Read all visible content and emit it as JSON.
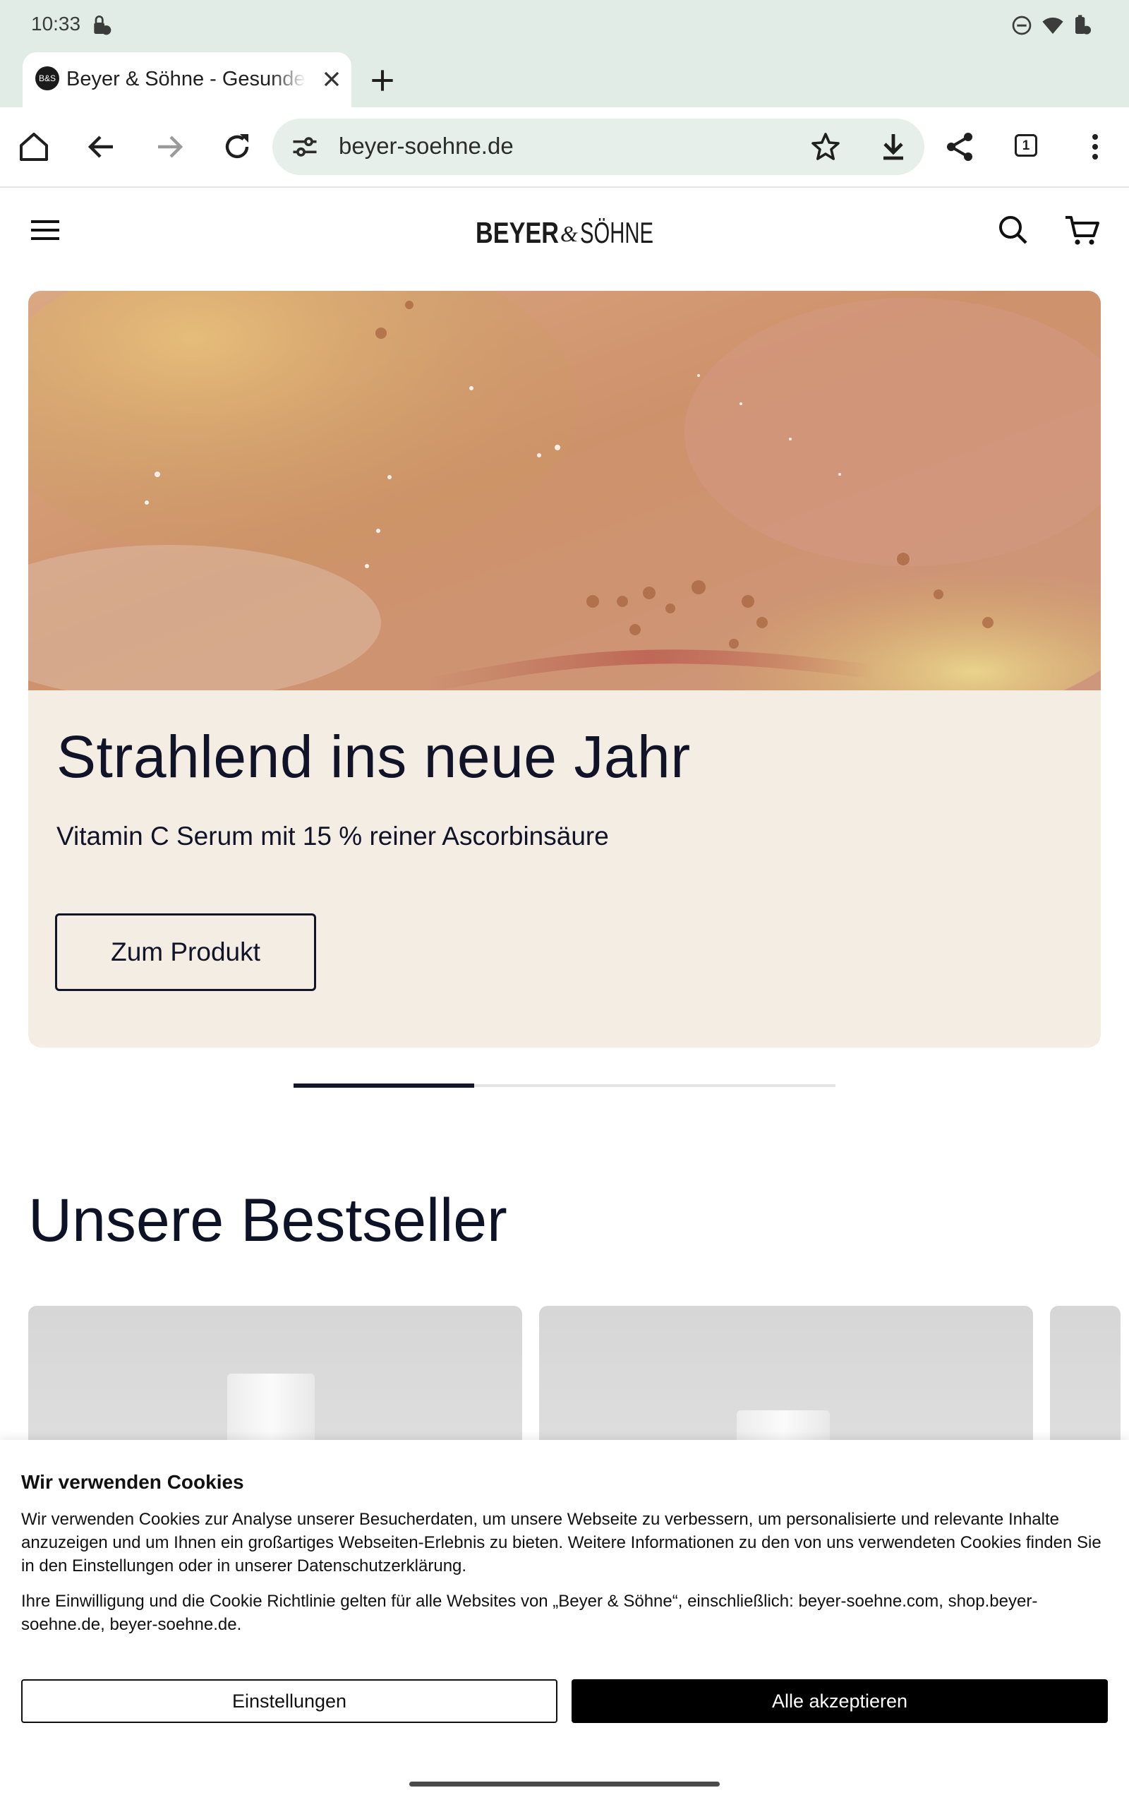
{
  "status_bar": {
    "time": "10:33",
    "icons": [
      "lock-notification-icon",
      "do-not-disturb-icon",
      "wifi-icon",
      "battery-icon"
    ]
  },
  "browser": {
    "tab": {
      "favicon_text": "B&S",
      "title": "Beyer & Söhne - Gesunde Haut"
    },
    "url": "beyer-soehne.de",
    "tab_count": "1"
  },
  "site": {
    "logo": {
      "left": "BEYER",
      "amp": "&",
      "right": "SÖHNE"
    },
    "hero": {
      "title": "Strahlend ins neue Jahr",
      "subtitle": "Vitamin C Serum mit 15 % reiner Ascorbinsäure",
      "cta": "Zum Produkt",
      "slide_progress": 0.333
    },
    "bestseller_title": "Unsere Bestseller"
  },
  "cookie": {
    "title": "Wir verwenden Cookies",
    "text1": "Wir verwenden Cookies zur Analyse unserer Besucherdaten, um unsere Webseite zu verbessern, um personalisierte und relevante Inhalte anzuzeigen und um Ihnen ein großartiges Webseiten-Erlebnis zu bieten. Weitere Informationen zu den von uns verwendeten Cookies finden Sie in den Einstellungen oder in unserer Datenschutzerklärung.",
    "text2": "Ihre Einwilligung und die Cookie Richtlinie gelten für alle Websites von „Beyer & Söhne“, einschließlich: beyer-soehne.com, shop.beyer-soehne.de, beyer-soehne.de.",
    "settings_label": "Einstellungen",
    "accept_label": "Alle akzeptieren"
  },
  "colors": {
    "chrome_bg": "#e2ece6",
    "hero_bg": "#f3ede3",
    "text_dark": "#111429",
    "accept_bg": "#000000"
  }
}
